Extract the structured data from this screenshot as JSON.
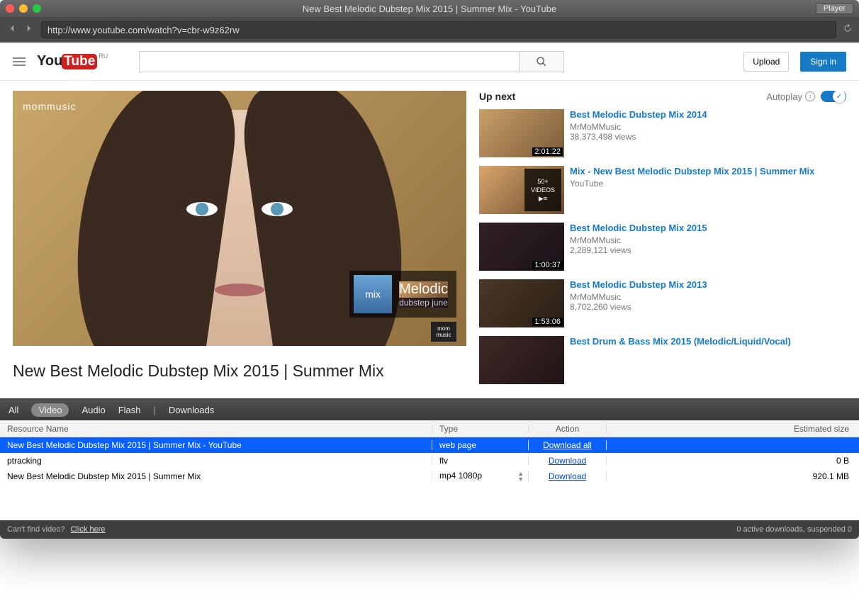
{
  "window": {
    "title": "New Best Melodic Dubstep Mix 2015 | Summer Mix - YouTube",
    "player_btn": "Player"
  },
  "toolbar": {
    "url": "http://www.youtube.com/watch?v=cbr-w9z62rw"
  },
  "yt": {
    "logo_you": "You",
    "logo_tube": "Tube",
    "logo_region": "RU",
    "search_placeholder": "",
    "upload": "Upload",
    "signin": "Sign in"
  },
  "video": {
    "watermark": "mommusic",
    "badge_sq": "mix",
    "badge_t1": "Melodic",
    "badge_t2": "dubstep june",
    "corner": "mom music",
    "title": "New Best Melodic Dubstep Mix 2015 | Summer Mix"
  },
  "upnext": {
    "label": "Up next",
    "autoplay": "Autoplay",
    "items": [
      {
        "title": "Best Melodic Dubstep Mix 2014",
        "channel": "MrMoMMusic",
        "views": "38,373,498 views",
        "duration": "2:01:22",
        "thumb": "t0"
      },
      {
        "title": "Mix - New Best Melodic Dubstep Mix 2015 | Summer Mix",
        "channel": "YouTube",
        "views": "",
        "overlay_count": "50+",
        "overlay_label": "VIDEOS",
        "thumb": "t1"
      },
      {
        "title": "Best Melodic Dubstep Mix 2015",
        "channel": "MrMoMMusic",
        "views": "2,289,121 views",
        "duration": "1:00:37",
        "thumb": "t2"
      },
      {
        "title": "Best Melodic Dubstep Mix 2013",
        "channel": "MrMoMMusic",
        "views": "8,702,260 views",
        "duration": "1:53:06",
        "thumb": "t3"
      },
      {
        "title": "Best Drum & Bass Mix 2015 (Melodic/Liquid/Vocal)",
        "channel": "",
        "views": "",
        "thumb": "t4"
      }
    ]
  },
  "dl": {
    "tabs": {
      "all": "All",
      "video": "Video",
      "audio": "Audio",
      "flash": "Flash",
      "downloads": "Downloads"
    },
    "cols": {
      "name": "Resource Name",
      "type": "Type",
      "action": "Action",
      "size": "Estimated size"
    },
    "rows": [
      {
        "name": "New Best Melodic Dubstep Mix 2015 | Summer Mix - YouTube",
        "type": "web page",
        "action": "Download all",
        "size": "",
        "sel": true
      },
      {
        "name": "ptracking",
        "type": "flv",
        "action": "Download",
        "size": "0 B"
      },
      {
        "name": "New Best Melodic Dubstep Mix 2015 | Summer Mix",
        "type": "mp4 1080p",
        "action": "Download",
        "size": "920.1 MB",
        "arrows": true
      }
    ],
    "foot_q": "Can't find video?",
    "foot_link": "Click here",
    "foot_status": "0 active downloads, suspended 0"
  }
}
